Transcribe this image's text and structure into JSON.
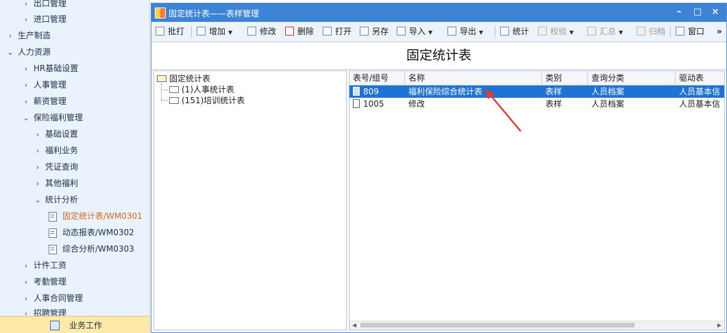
{
  "nav": {
    "items": [
      {
        "label": "出口管理",
        "expanded": false
      },
      {
        "label": "进口管理",
        "expanded": false
      },
      {
        "label": "生产制造",
        "expanded": false
      },
      {
        "label": "人力资源",
        "expanded": true
      },
      {
        "label": "HR基础设置",
        "expanded": false
      },
      {
        "label": "人事管理",
        "expanded": false
      },
      {
        "label": "薪资管理",
        "expanded": false
      },
      {
        "label": "保险福利管理",
        "expanded": true
      },
      {
        "label": "基础设置",
        "expanded": false
      },
      {
        "label": "福利业务",
        "expanded": false
      },
      {
        "label": "凭证查询",
        "expanded": false
      },
      {
        "label": "其他福利",
        "expanded": false
      },
      {
        "label": "统计分析",
        "expanded": true
      },
      {
        "label": "固定统计表/WM0301",
        "selected": true
      },
      {
        "label": "动态报表/WM0302"
      },
      {
        "label": "综合分析/WM0303"
      },
      {
        "label": "计件工资",
        "expanded": false
      },
      {
        "label": "考勤管理",
        "expanded": false
      },
      {
        "label": "人事合同管理",
        "expanded": false
      },
      {
        "label": "招聘管理",
        "expanded": false
      }
    ],
    "footer_label": "业务工作"
  },
  "window": {
    "title": "固定统计表——表样管理",
    "min_icon": "minimize-icon",
    "max_icon": "maximize-icon",
    "close_icon": "close-icon"
  },
  "toolbar": {
    "batch_print": "批打",
    "add": "增加",
    "edit": "修改",
    "delete": "删除",
    "open": "打开",
    "save_as": "另存",
    "import": "导入",
    "export": "导出",
    "stats": "统计",
    "verify": "校验",
    "summary": "汇总",
    "archive": "归档",
    "window": "窗口",
    "more": "»"
  },
  "heading": "固定统计表",
  "tree": {
    "root": "固定统计表",
    "children": [
      "(1)人事统计表",
      "(151)培训统计表"
    ]
  },
  "grid": {
    "columns": [
      "表号/组号",
      "名称",
      "类别",
      "查询分类",
      "驱动表"
    ],
    "rows": [
      {
        "code": "809",
        "name": "福利保险综合统计表",
        "category": "表样",
        "query": "人员档案",
        "driver": "人员基本信",
        "selected": true
      },
      {
        "code": "1005",
        "name": "修改",
        "category": "表样",
        "query": "人员档案",
        "driver": "人员基本信",
        "selected": false
      }
    ]
  },
  "colors": {
    "title_bar": "#3d83d6",
    "selection": "#1e73d4",
    "annotation_arrow": "#e53935",
    "selected_nav_text": "#d2691e"
  }
}
